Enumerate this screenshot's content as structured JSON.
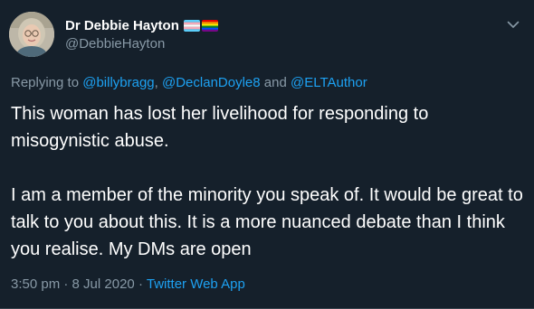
{
  "author": {
    "display_name": "Dr Debbie Hayton",
    "handle": "@DebbieHayton",
    "flags": [
      "transgender-flag",
      "rainbow-flag"
    ]
  },
  "reply": {
    "prefix": "Replying to",
    "mention_1": "@billybragg",
    "sep_1": ",",
    "mention_2": "@DeclanDoyle8",
    "and_word": "and",
    "mention_3": "@ELTAuthor"
  },
  "body": {
    "paragraph_1": "This woman has lost her livelihood for responding to misogynistic abuse.",
    "paragraph_2": "I am a member of the minority you speak of. It would be great to talk to you about this. It is a more nuanced debate than I think you realise. My DMs are open"
  },
  "meta": {
    "time": "3:50 pm",
    "dot_1": "·",
    "date": "8 Jul 2020",
    "dot_2": "·",
    "app": "Twitter Web App"
  },
  "icons": {
    "caret": "chevron-down-icon",
    "avatar": "avatar"
  },
  "colors": {
    "background": "#15202b",
    "text_primary": "#ffffff",
    "text_secondary": "#8899a6",
    "link": "#1da1f2"
  }
}
